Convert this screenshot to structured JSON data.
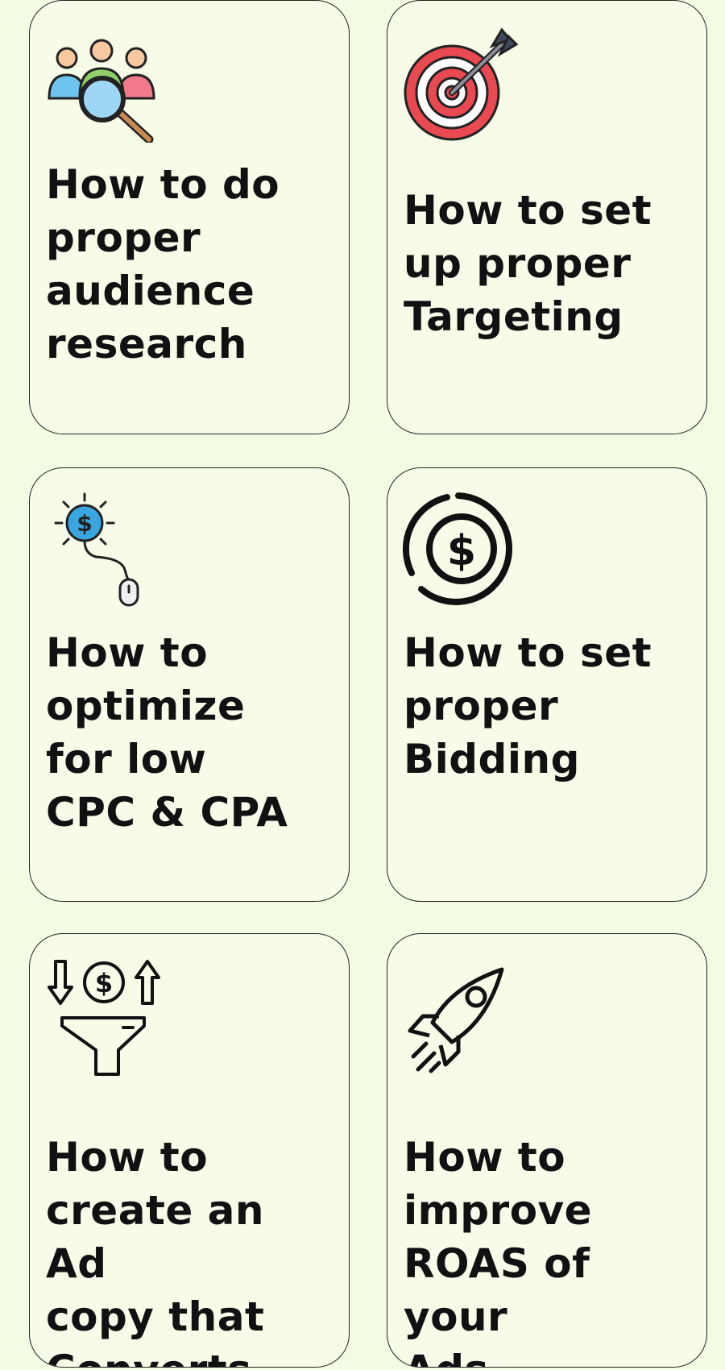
{
  "cards": [
    {
      "icon": "audience-research-icon",
      "title_lines": [
        "How to do",
        "proper",
        "audience",
        "research"
      ]
    },
    {
      "icon": "target-arrow-icon",
      "title_lines": [
        "How to set",
        "up proper",
        "Targeting"
      ]
    },
    {
      "icon": "dollar-click-icon",
      "title_lines": [
        "How to",
        "optimize",
        "for low",
        "CPC & CPA"
      ]
    },
    {
      "icon": "dollar-coin-icon",
      "title_lines": [
        "How to set",
        "proper",
        "Bidding"
      ]
    },
    {
      "icon": "money-funnel-icon",
      "title_lines": [
        "How to",
        "create an Ad",
        "copy that",
        "Converts"
      ]
    },
    {
      "icon": "rocket-icon",
      "title_lines": [
        "How to",
        "improve",
        "ROAS of your",
        "Ads"
      ]
    }
  ],
  "colors": {
    "background": "#f3fbe3",
    "card_border": "#222222",
    "text": "#111111",
    "target_red": "#e94a52",
    "audience_blue": "#6fc3ef",
    "audience_green": "#8fd06a",
    "audience_pink": "#f07a8a",
    "dollar_blue": "#3aa6e0"
  }
}
